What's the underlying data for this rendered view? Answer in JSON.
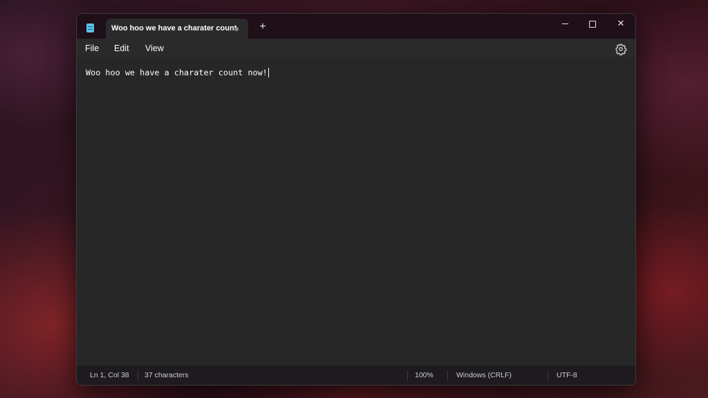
{
  "window": {
    "tab_title": "Woo hoo we have a charater count",
    "new_tab_label": "+",
    "close_label": "✕"
  },
  "menu": {
    "file": "File",
    "edit": "Edit",
    "view": "View"
  },
  "editor": {
    "content": "Woo hoo we have a charater count now!"
  },
  "status": {
    "position": "Ln 1, Col 38",
    "characters": "37 characters",
    "zoom": "100%",
    "line_ending": "Windows (CRLF)",
    "encoding": "UTF-8"
  },
  "icons": {
    "app": "notepad-icon",
    "unsaved": "unsaved-dot-icon",
    "settings": "gear-icon"
  }
}
